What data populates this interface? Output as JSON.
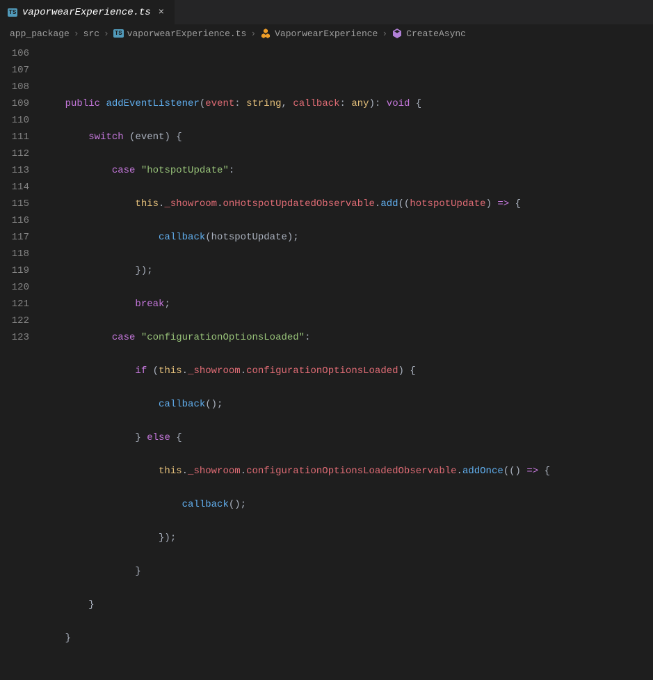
{
  "tab": {
    "filename": "vaporwearExperience.ts",
    "lang_badge": "TS",
    "close_glyph": "×"
  },
  "breadcrumb": {
    "items": [
      {
        "label": "app_package",
        "icon": null
      },
      {
        "label": "src",
        "icon": null
      },
      {
        "label": "vaporwearExperience.ts",
        "icon": "ts"
      },
      {
        "label": "VaporwearExperience",
        "icon": "class"
      },
      {
        "label": "CreateAsync",
        "icon": "method"
      }
    ],
    "separator": "›"
  },
  "line_numbers": [
    "106",
    "107",
    "108",
    "109",
    "110",
    "111",
    "112",
    "113",
    "114",
    "115",
    "116",
    "117",
    "118",
    "119",
    "120",
    "121",
    "122",
    "123"
  ],
  "code": {
    "l106": "",
    "l107": {
      "kw_public": "public",
      "fn": "addEventListener",
      "param1": "event",
      "type1": "string",
      "param2": "callback",
      "type2": "any",
      "ret": "void"
    },
    "l108": {
      "kw_switch": "switch",
      "expr": "event"
    },
    "l109": {
      "kw_case": "case",
      "str": "\"hotspotUpdate\""
    },
    "l110": {
      "this": "this",
      "prop1": "_showroom",
      "prop2": "onHotspotUpdatedObservable",
      "fn": "add",
      "param": "hotspotUpdate"
    },
    "l111": {
      "fn": "callback",
      "arg": "hotspotUpdate"
    },
    "l112_close": "});",
    "l113_break": "break",
    "l114": {
      "kw_case": "case",
      "str": "\"configurationOptionsLoaded\""
    },
    "l115": {
      "kw_if": "if",
      "this": "this",
      "prop1": "_showroom",
      "prop2": "configurationOptionsLoaded"
    },
    "l116_callback": "callback",
    "l117": {
      "kw_else": "else"
    },
    "l118": {
      "this": "this",
      "prop1": "_showroom",
      "prop2": "configurationOptionsLoadedObservable",
      "fn": "addOnce"
    },
    "l119_callback": "callback",
    "l120_close": "});",
    "l121_brace": "}",
    "l122_brace": "}",
    "l123_brace": "}"
  }
}
